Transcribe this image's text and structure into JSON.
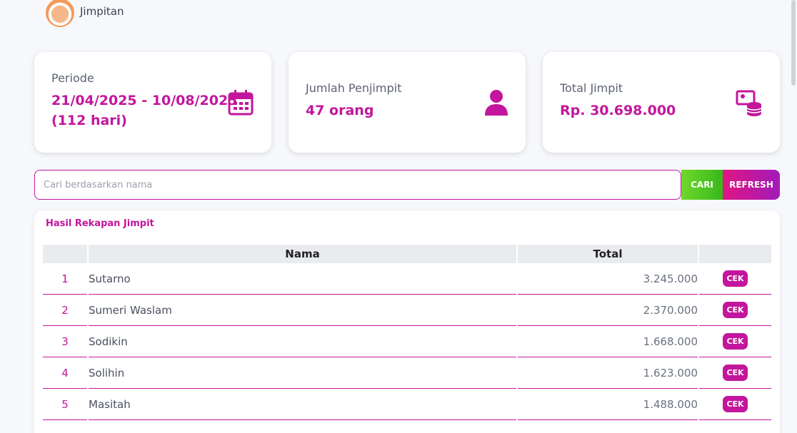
{
  "header": {
    "title": "Jimpitan"
  },
  "cards": {
    "periode": {
      "label": "Periode",
      "line1": "21/04/2025 - 10/08/2025",
      "line2": "(112 hari)"
    },
    "penjimpit": {
      "label": "Jumlah Penjimpit",
      "value": "47 orang"
    },
    "total": {
      "label": "Total Jimpit",
      "value": "Rp. 30.698.000"
    }
  },
  "search": {
    "placeholder": "Cari berdasarkan nama",
    "value": ""
  },
  "buttons": {
    "cari": "CARI",
    "refresh": "REFRESH"
  },
  "panel": {
    "title": "Hasil Rekapan Jimpit"
  },
  "table": {
    "headers": {
      "no": "",
      "nama": "Nama",
      "total": "Total",
      "aksi": ""
    },
    "rows": [
      {
        "no": "1",
        "nama": "Sutarno",
        "total": "3.245.000",
        "action": "CEK"
      },
      {
        "no": "2",
        "nama": "Sumeri Waslam",
        "total": "2.370.000",
        "action": "CEK"
      },
      {
        "no": "3",
        "nama": "Sodikin",
        "total": "1.668.000",
        "action": "CEK"
      },
      {
        "no": "4",
        "nama": "Solihin",
        "total": "1.623.000",
        "action": "CEK"
      },
      {
        "no": "5",
        "nama": "Masitah",
        "total": "1.488.000",
        "action": "CEK"
      }
    ]
  },
  "colors": {
    "accent": "#c3169c",
    "green": "#38b81a"
  }
}
